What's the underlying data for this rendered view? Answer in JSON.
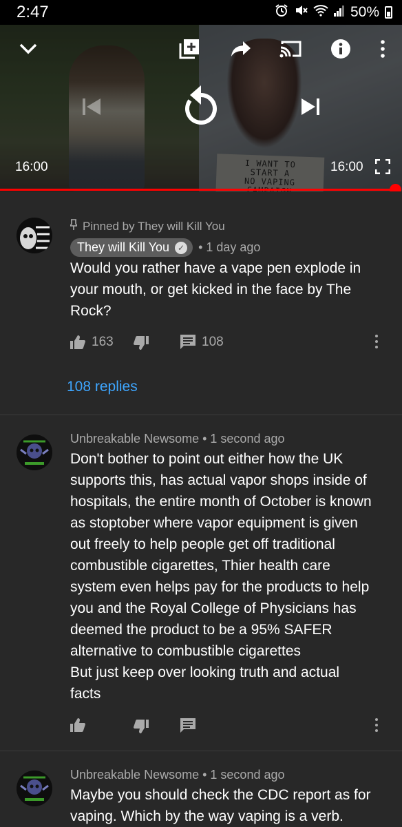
{
  "status_bar": {
    "time": "2:47",
    "battery": "50%",
    "icons": [
      "alarm-icon",
      "mute-icon",
      "wifi-icon",
      "signal-icon",
      "battery-icon"
    ]
  },
  "player": {
    "current_time": "16:00",
    "duration": "16:00",
    "progress_fraction": 1.0,
    "sign_text": [
      "I WANT TO",
      "START A",
      "NO VAPING",
      "CAMPAIGN"
    ],
    "controls": [
      "collapse-icon",
      "add-to-playlist-icon",
      "share-icon",
      "cast-icon",
      "info-icon",
      "more-icon",
      "previous-icon",
      "replay-icon",
      "next-icon",
      "fullscreen-icon"
    ],
    "accent_color": "#ff0000"
  },
  "comments": [
    {
      "pinned_label": "Pinned by They will Kill You",
      "author": "They will Kill You",
      "verified": true,
      "time": "• 1 day ago",
      "text": "Would you rather have a vape pen explode in your mouth, or get kicked in the face by The Rock?",
      "likes": "163",
      "reply_count": "108",
      "replies_link": "108 replies"
    },
    {
      "author": "Unbreakable Newsome",
      "time": "1 second ago",
      "text": "Don't bother to point out either how the UK supports this, has actual vapor shops inside of hospitals, the entire month of October is known as stoptober  where vapor equipment is given out freely to help people get off traditional combustible cigarettes, Thier health care system even helps pay for the products to help you and the Royal College of Physicians has deemed the product to be a 95% SAFER alternative to combustible cigarettes\nBut just keep over looking truth and actual facts"
    },
    {
      "author": "Unbreakable Newsome",
      "time": "1 second ago",
      "text": "Maybe you should check the CDC report as for vaping. Which by the way vaping is a verb."
    }
  ],
  "colors": {
    "background": "#282828",
    "link": "#3ea6ff",
    "secondary_text": "#aaaaaa"
  }
}
